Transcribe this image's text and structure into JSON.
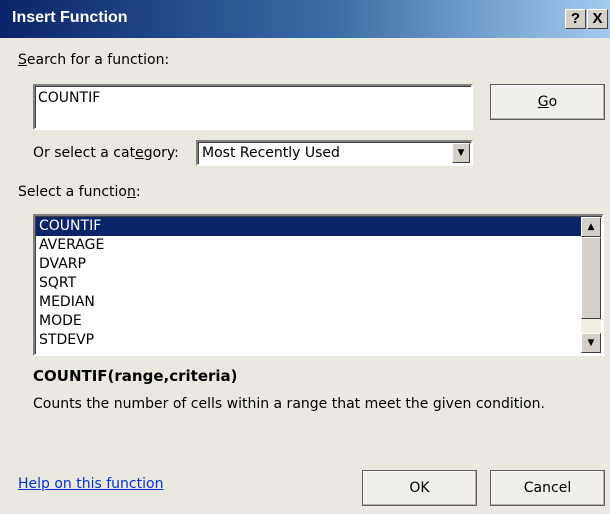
{
  "window": {
    "title": "Insert Function",
    "help_button": "?",
    "close_button": "X"
  },
  "search": {
    "label": "Search for a function:",
    "value": "COUNTIF",
    "go_label": "Go"
  },
  "category": {
    "label": "Or select a category:",
    "selected": "Most Recently Used"
  },
  "functions": {
    "label": "Select a function:",
    "items": [
      "COUNTIF",
      "AVERAGE",
      "DVARP",
      "SQRT",
      "MEDIAN",
      "MODE",
      "STDEVP"
    ],
    "selected": "COUNTIF"
  },
  "details": {
    "signature": "COUNTIF(range,criteria)",
    "description": "Counts the number of cells within a range that meet the given condition."
  },
  "footer": {
    "help_link": "Help on this function",
    "ok_label": "OK",
    "cancel_label": "Cancel"
  },
  "colors": {
    "title_gradient_start": "#0a246a",
    "selection": "#0a246a",
    "link": "#0033cc",
    "dialog_bg": "#ebe9df"
  }
}
